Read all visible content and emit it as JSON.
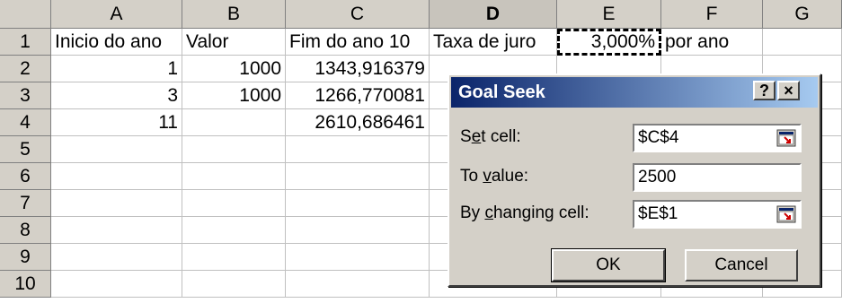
{
  "columns": [
    "A",
    "B",
    "C",
    "D",
    "E",
    "F",
    "G"
  ],
  "active_column": "D",
  "rows": [
    {
      "num": "1",
      "A": "Inicio do ano",
      "B": "Valor",
      "C": "Fim do ano 10",
      "D": "Taxa de juro",
      "E": "3,000%",
      "F": "por ano"
    },
    {
      "num": "2",
      "A": "1",
      "B": "1000",
      "C": "1343,916379"
    },
    {
      "num": "3",
      "A": "3",
      "B": "1000",
      "C": "1266,770081"
    },
    {
      "num": "4",
      "A": "11",
      "B": "",
      "C": "2610,686461"
    },
    {
      "num": "5"
    },
    {
      "num": "6"
    },
    {
      "num": "7"
    },
    {
      "num": "8"
    },
    {
      "num": "9"
    },
    {
      "num": "10"
    }
  ],
  "dialog": {
    "title": "Goal Seek",
    "help_label": "?",
    "close_label": "×",
    "set_cell": {
      "pre": "S",
      "acc": "e",
      "post": "t cell:",
      "value": "$C$4"
    },
    "to_value": {
      "pre": "To ",
      "acc": "v",
      "post": "alue:",
      "value": "2500"
    },
    "changing_cell": {
      "pre": "By ",
      "acc": "c",
      "post": "hanging cell:",
      "value": "$E$1"
    },
    "ok_label": "OK",
    "cancel_label": "Cancel"
  }
}
